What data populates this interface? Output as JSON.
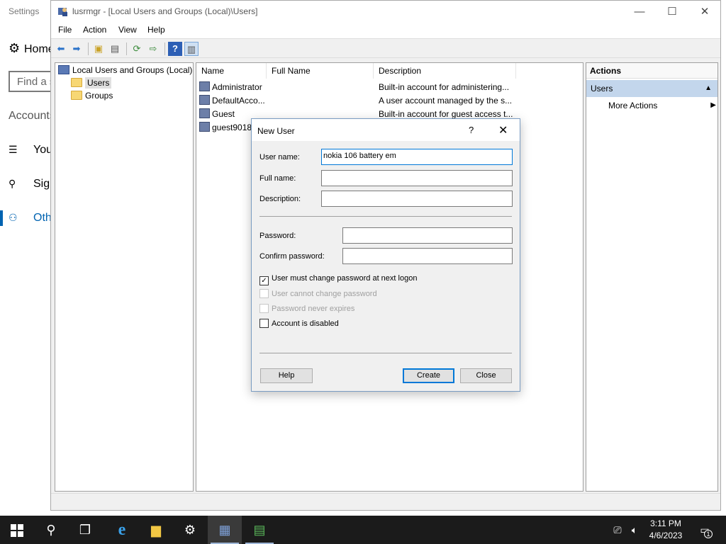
{
  "settings": {
    "title": "Settings",
    "home": "Home",
    "search_placeholder": "Find a setting",
    "section": "Accounts",
    "nav": [
      {
        "label": "Your info",
        "icon": "person-card-icon"
      },
      {
        "label": "Sign-in options",
        "icon": "key-icon"
      },
      {
        "label": "Other users",
        "icon": "person-add-icon"
      }
    ]
  },
  "mmc": {
    "title": "lusrmgr - [Local Users and Groups (Local)\\Users]",
    "menu": [
      "File",
      "Action",
      "View",
      "Help"
    ],
    "tree": {
      "root": "Local Users and Groups (Local)",
      "children": [
        "Users",
        "Groups"
      ]
    },
    "columns": [
      "Name",
      "Full Name",
      "Description"
    ],
    "rows": [
      {
        "name": "Administrator",
        "full_name": "",
        "description": "Built-in account for administering..."
      },
      {
        "name": "DefaultAcco...",
        "full_name": "",
        "description": "A user account managed by the s..."
      },
      {
        "name": "Guest",
        "full_name": "",
        "description": "Built-in account for guest access t..."
      },
      {
        "name": "guest9018",
        "full_name": "",
        "description": ""
      }
    ],
    "actions": {
      "header": "Actions",
      "section": "Users",
      "items": [
        "More Actions"
      ]
    }
  },
  "dialog": {
    "title": "New User",
    "help_glyph": "?",
    "fields": {
      "username_label": "User name:",
      "username_value": "nokia 106 battery em",
      "fullname_label": "Full name:",
      "fullname_value": "",
      "description_label": "Description:",
      "description_value": "",
      "password_label": "Password:",
      "confirm_label": "Confirm password:"
    },
    "checkboxes": [
      {
        "label": "User must change password at next logon",
        "checked": true,
        "enabled": true
      },
      {
        "label": "User cannot change password",
        "checked": false,
        "enabled": false
      },
      {
        "label": "Password never expires",
        "checked": false,
        "enabled": false
      },
      {
        "label": "Account is disabled",
        "checked": false,
        "enabled": true
      }
    ],
    "buttons": {
      "help": "Help",
      "create": "Create",
      "close": "Close"
    }
  },
  "taskbar": {
    "clock_time": "3:11 PM",
    "clock_date": "4/6/2023",
    "notification_count": "1"
  },
  "colors": {
    "accent": "#0078d7",
    "selection": "#c3d6ec",
    "taskbar": "#1b1b1b"
  }
}
